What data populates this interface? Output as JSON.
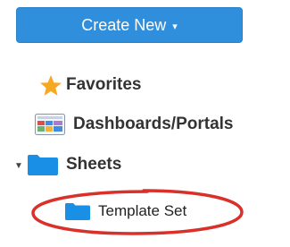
{
  "create_button": {
    "label": "Create New",
    "caret": "▾"
  },
  "nav": {
    "favorites": {
      "label": "Favorites",
      "icon": "star-icon"
    },
    "dashboards": {
      "label": "Dashboards/Portals",
      "icon": "dashboard-icon"
    },
    "sheets": {
      "label": "Sheets",
      "icon": "folder-icon",
      "expanded": true,
      "children": [
        {
          "label": "Template Set",
          "icon": "folder-icon"
        }
      ]
    }
  },
  "colors": {
    "button_bg": "#2f8fdd",
    "folder": "#1a8fe6",
    "star": "#f7a823",
    "annotation": "#d9302a"
  }
}
